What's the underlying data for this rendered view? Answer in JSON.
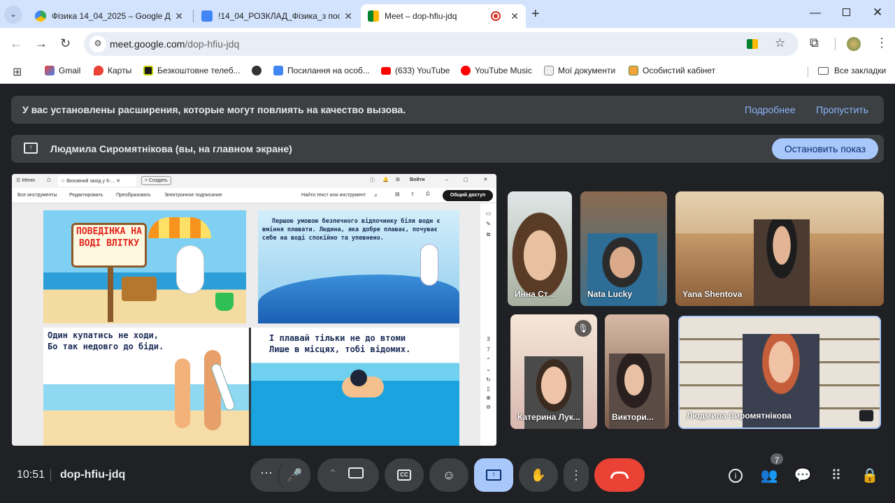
{
  "browser": {
    "tabs": [
      {
        "label": "Фізика 14_04_2025 – Google Д",
        "active": false
      },
      {
        "label": "!14_04_РОЗКЛАД_Фізика_з пос",
        "active": false
      },
      {
        "label": "Meet – dop-hfiu-jdq",
        "active": true
      }
    ],
    "url_domain": "meet.google.com",
    "url_path": "/dop-hfiu-jdq",
    "bookmarks": [
      "Gmail",
      "Карты",
      "Безкоштовне телеб...",
      "Посилання на особ...",
      "(633) YouTube",
      "YouTube Music",
      "Мої документи",
      "Особистий кабінет"
    ],
    "all_bookmarks": "Все закладки"
  },
  "meet": {
    "ext_banner": {
      "text": "У вас установлены расширения, которые могут повлиять на качество вызова.",
      "more": "Подробнее",
      "skip": "Пропустить"
    },
    "present_banner": {
      "text": "Людмила Сиромятнікова (вы, на главном экране)",
      "stop": "Остановить показ"
    },
    "participants": [
      {
        "name": "Инна Ст...",
        "muted": false
      },
      {
        "name": "Nata Lucky",
        "muted": false
      },
      {
        "name": "Yana Shentova",
        "muted": false
      },
      {
        "name": "Катерина Лук...",
        "muted": true
      },
      {
        "name": "Виктори...",
        "muted": false
      },
      {
        "name": "Людмила Сиромятнікова",
        "muted": false
      }
    ],
    "time": "10:51",
    "meeting_code": "dop-hfiu-jdq",
    "people_count": "7",
    "colors": {
      "bg": "#202124",
      "tile": "#3c4043",
      "accent": "#a8c7fa",
      "end": "#ea4335"
    }
  },
  "shared_doc": {
    "toolbar": {
      "menu": "Меню",
      "doc_tab": "Виховний захід у 6-...",
      "create": "Создать",
      "login": "Войти",
      "tools": [
        "Все инструменты",
        "Редактировать",
        "Преобразовать",
        "Электронное подписание"
      ],
      "search": "Найти текст или инструмент",
      "share": "Общий доступ",
      "page_current": "3",
      "page_total": "7"
    },
    "panels": {
      "sign": "ПОВЕДІНКА НА ВОДІ ВЛІТКУ",
      "p2": "Першою умовою безпечного відпочинку біля води є вміння плавати. Людина, яка добре плаває, почуває себе на воді спокійно та упевнено.",
      "p3_l1": "Один купатись не ходи,",
      "p3_l2": "Бо так недовго до біди.",
      "p4_l1": "І плавай тільки не до втоми",
      "p4_l2": "Лише в місцях, тобі відомих."
    }
  }
}
